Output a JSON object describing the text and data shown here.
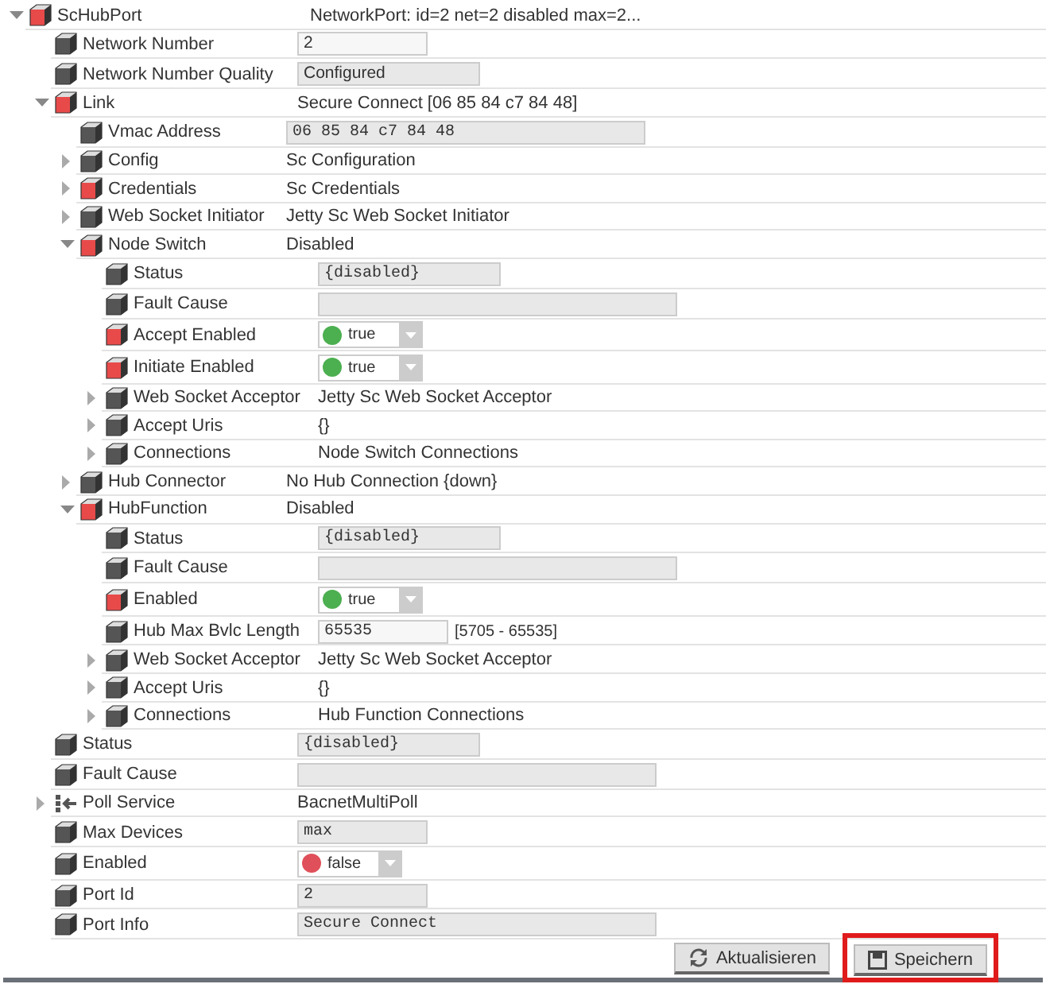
{
  "tree": [
    {
      "label": "ScHubPort",
      "color": "#e84a4a",
      "expanded": true,
      "kind": "text",
      "value": "NetworkPort: id=2 net=2 disabled max=2...",
      "children": [
        {
          "label": "Network Number",
          "color": "#555555",
          "kind": "field",
          "editable": true,
          "value": "2"
        },
        {
          "label": "Network Number Quality",
          "color": "#555555",
          "kind": "field",
          "editable": false,
          "value": "Configured"
        },
        {
          "label": "Link",
          "color": "#e84a4a",
          "expanded": true,
          "kind": "text",
          "value": "Secure Connect [06 85 84 c7 84 48]",
          "children": [
            {
              "label": "Vmac Address",
              "color": "#555555",
              "kind": "code_field",
              "editable": false,
              "value": "06 85 84 c7 84 48"
            },
            {
              "label": "Config",
              "color": "#555555",
              "expanded": false,
              "kind": "text",
              "value": "Sc Configuration"
            },
            {
              "label": "Credentials",
              "color": "#e84a4a",
              "expanded": false,
              "kind": "text",
              "value": "Sc Credentials"
            },
            {
              "label": "Web Socket Initiator",
              "color": "#555555",
              "expanded": false,
              "kind": "text",
              "value": "Jetty Sc Web Socket Initiator"
            },
            {
              "label": "Node Switch",
              "color": "#e84a4a",
              "expanded": true,
              "kind": "text",
              "value": "Disabled",
              "children": [
                {
                  "label": "Status",
                  "color": "#555555",
                  "kind": "code_field",
                  "editable": false,
                  "value": "{disabled}"
                },
                {
                  "label": "Fault Cause",
                  "color": "#555555",
                  "kind": "code_field",
                  "editable": false
                },
                {
                  "label": "Accept Enabled",
                  "color": "#e84a4a",
                  "kind": "toggle",
                  "on": true,
                  "value": "true"
                },
                {
                  "label": "Initiate Enabled",
                  "color": "#e84a4a",
                  "kind": "toggle",
                  "on": true,
                  "value": "true"
                },
                {
                  "label": "Web Socket Acceptor",
                  "color": "#555555",
                  "expanded": false,
                  "kind": "text",
                  "value": "Jetty Sc Web Socket Acceptor"
                },
                {
                  "label": "Accept Uris",
                  "color": "#555555",
                  "expanded": false,
                  "kind": "text",
                  "value": "{}"
                },
                {
                  "label": "Connections",
                  "color": "#555555",
                  "expanded": false,
                  "kind": "text",
                  "value": "Node Switch Connections"
                }
              ]
            },
            {
              "label": "Hub Connector",
              "color": "#555555",
              "expanded": false,
              "kind": "text",
              "value": "No Hub Connection {down}"
            },
            {
              "label": "HubFunction",
              "color": "#e84a4a",
              "expanded": true,
              "kind": "text",
              "value": "Disabled",
              "children": [
                {
                  "label": "Status",
                  "color": "#555555",
                  "kind": "code_field",
                  "editable": false,
                  "value": "{disabled}"
                },
                {
                  "label": "Fault Cause",
                  "color": "#555555",
                  "kind": "code_field",
                  "editable": false
                },
                {
                  "label": "Enabled",
                  "color": "#e84a4a",
                  "kind": "toggle",
                  "on": true,
                  "value": "true"
                },
                {
                  "label": "Hub Max Bvlc Length",
                  "color": "#555555",
                  "kind": "code_field",
                  "editable": true,
                  "value": "65535",
                  "hint": "[5705 - 65535]"
                },
                {
                  "label": "Web Socket Acceptor",
                  "color": "#555555",
                  "expanded": false,
                  "kind": "text",
                  "value": "Jetty Sc Web Socket Acceptor"
                },
                {
                  "label": "Accept Uris",
                  "color": "#555555",
                  "expanded": false,
                  "kind": "text",
                  "value": "{}"
                },
                {
                  "label": "Connections",
                  "color": "#555555",
                  "expanded": false,
                  "kind": "text",
                  "value": "Hub Function Connections"
                }
              ]
            }
          ]
        },
        {
          "label": "Status",
          "color": "#555555",
          "kind": "code_field",
          "editable": false,
          "value": "{disabled}"
        },
        {
          "label": "Fault Cause",
          "color": "#555555",
          "kind": "code_field",
          "editable": false
        },
        {
          "label": "Poll Service",
          "color": "#555555",
          "expanded": false,
          "kind": "service",
          "value": "BacnetMultiPoll"
        },
        {
          "label": "Max Devices",
          "color": "#555555",
          "kind": "code_field",
          "editable": false,
          "value": "max"
        },
        {
          "label": "Enabled",
          "color": "#555555",
          "kind": "toggle",
          "on": false,
          "value": "false"
        },
        {
          "label": "Port Id",
          "color": "#555555",
          "kind": "code_field",
          "editable": false,
          "value": "2"
        },
        {
          "label": "Port Info",
          "color": "#555555",
          "kind": "code_field",
          "editable": false,
          "value": "Secure Connect"
        }
      ]
    }
  ],
  "buttons": [
    {
      "label": "Aktualisieren",
      "highlighted": false
    },
    {
      "label": "Speichern",
      "highlighted": true
    }
  ]
}
